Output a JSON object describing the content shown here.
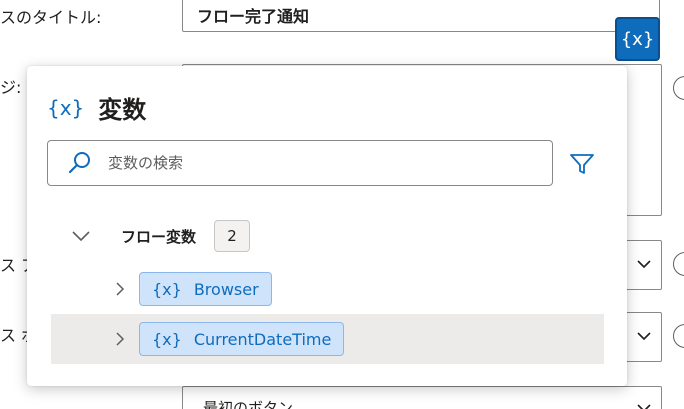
{
  "background_form": {
    "title_label": "スのタイトル:",
    "title_value": "フロー完了通知",
    "message_label": "ジ:",
    "field3_label": "ス ア",
    "field4_label": "ス ボ",
    "field5_value": "最初のボタン"
  },
  "variables_button": {
    "label": "{x}"
  },
  "panel": {
    "icon": "{x}",
    "title": "変数",
    "search": {
      "placeholder": "変数の検索",
      "value": ""
    },
    "group": {
      "label": "フロー変数",
      "count": "2"
    },
    "variables": [
      {
        "icon": "{x}",
        "name": "Browser"
      },
      {
        "icon": "{x}",
        "name": "CurrentDateTime"
      }
    ]
  },
  "colors": {
    "accent": "#0f6cbd",
    "chip_bg": "#cfe4fa",
    "hover_row": "#edebe9"
  }
}
